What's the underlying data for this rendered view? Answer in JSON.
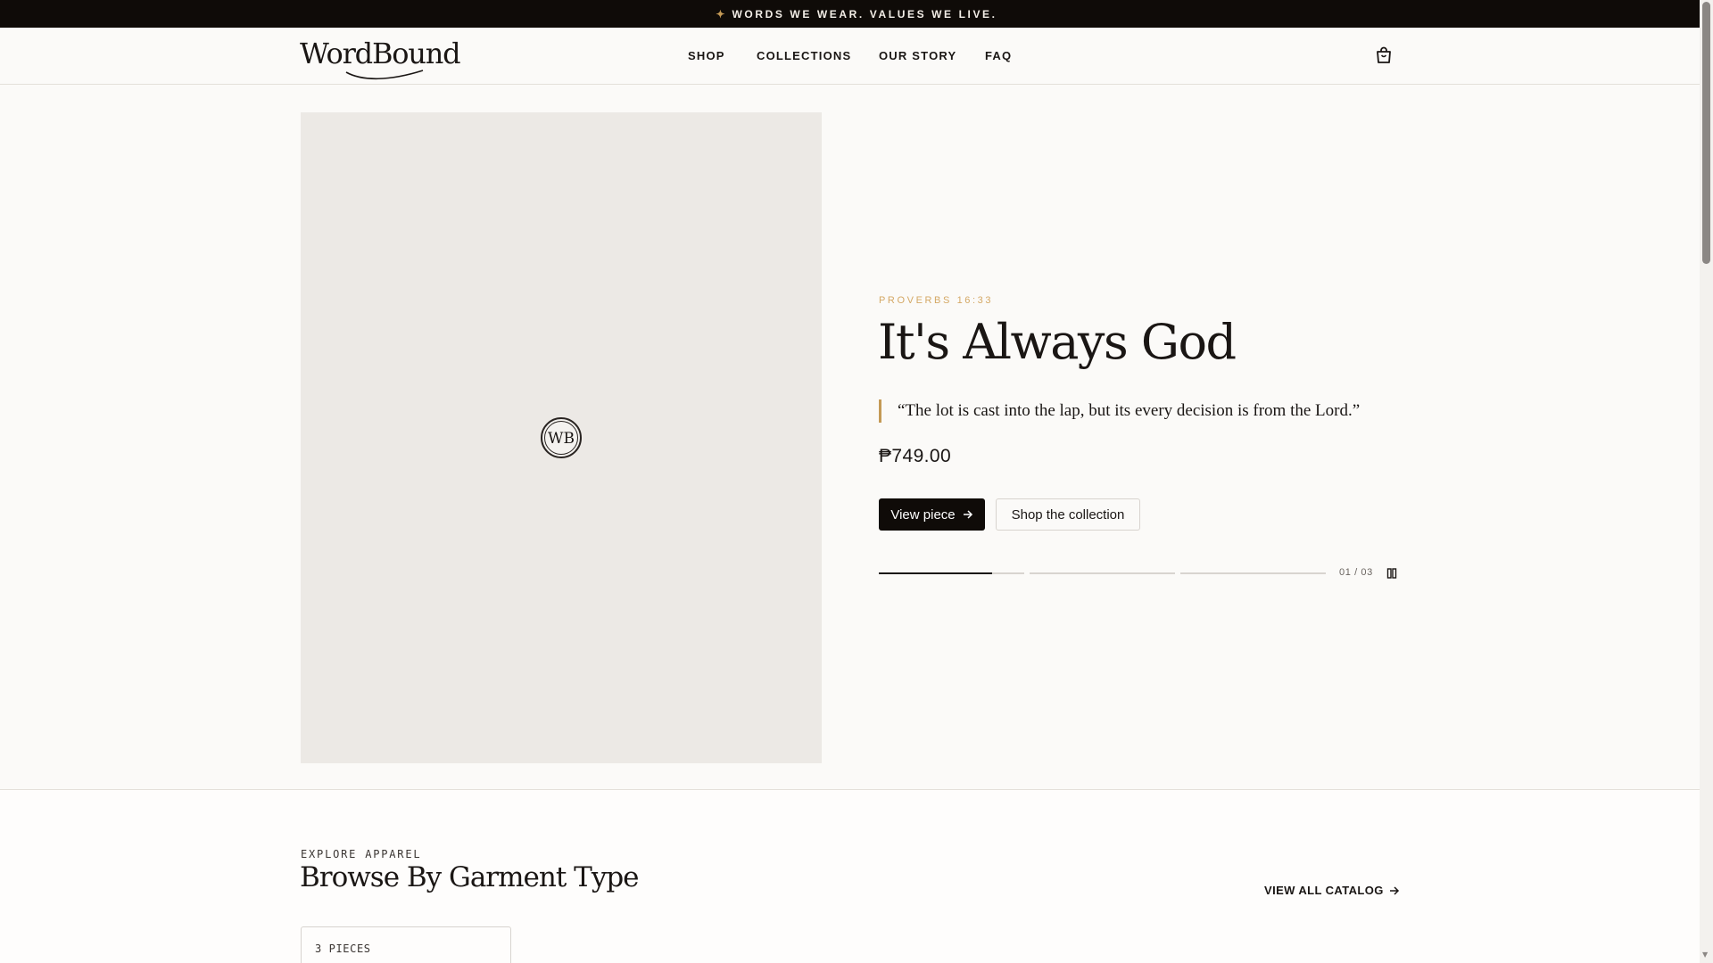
{
  "announcement": {
    "icon": "sparkle-icon",
    "text": "WORDS WE WEAR. VALUES WE LIVE."
  },
  "header": {
    "logo": "WordBound",
    "nav": [
      "SHOP",
      "COLLECTIONS",
      "OUR STORY",
      "FAQ"
    ],
    "cart_icon": "shopping-bag-icon"
  },
  "hero": {
    "image_badge": "WB",
    "verse_ref": "PROVERBS 16:33",
    "title": "It's Always God",
    "quote": "“The lot is cast into the lap, but its every decision is from the Lord.”",
    "price": "₱749.00",
    "primary_button": "View piece",
    "secondary_button": "Shop the collection",
    "slide_counter": "01 / 03",
    "slides_total": 3,
    "current_slide": 1,
    "current_slide_progress": 0.78,
    "pause_icon": "pause-icon"
  },
  "browse": {
    "eyebrow": "EXPLORE APPAREL",
    "title": "Browse By Garment Type",
    "view_all": "VIEW ALL CATALOG",
    "cards": [
      {
        "count_label": "3 PIECES"
      }
    ]
  },
  "colors": {
    "announcement_bg": "#0f0b08",
    "accent_gold": "#c49a56",
    "text": "#1a1614",
    "page_bg": "#fbfaf8",
    "image_placeholder": "#ece9e5"
  }
}
